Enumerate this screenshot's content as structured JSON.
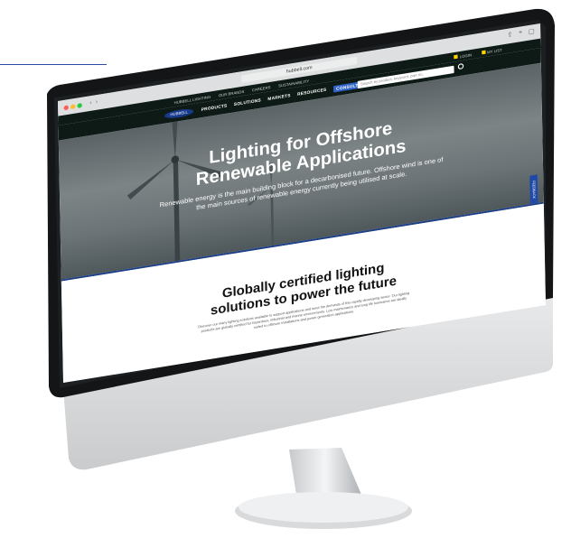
{
  "browser": {
    "url": "hubbell.com",
    "nav_back_icon": "chevron-left-icon",
    "nav_forward_icon": "chevron-right-icon"
  },
  "site": {
    "top_links": [
      "HUBBELL LIGHTING",
      "OUR BRANDS",
      "CAREERS",
      "SUSTAINABILITY"
    ],
    "login_label": "LOGIN",
    "my_list_label": "MY LIST",
    "logo_text": "HUBBELL",
    "menu": [
      "PRODUCTS",
      "SOLUTIONS",
      "MARKETS",
      "RESOURCES",
      "CONSULTING"
    ],
    "search_placeholder": "Search by product, keyword, part no.",
    "feedback_label": "FEEDBACK"
  },
  "hero": {
    "title_line1": "Lighting for Offshore",
    "title_line2": "Renewable Applications",
    "subtitle": "Renewable energy is the main building block for a decarbonised future. Offshore wind is one of the main sources of renewable energy currently being utilised at scale."
  },
  "section": {
    "heading_line1": "Globally certified lighting",
    "heading_line2": "solutions to power the future",
    "body": "Discover our many lighting solutions available to support applications and meet the demands of this rapidly developing sector. Our lighting products are globally certified for hazardous, industrial and marine environments. Low maintenance and long life luminaires are ideally suited to offshore installations and power generation applications."
  },
  "colors": {
    "accent_line": "#2a4aa3",
    "site_nav": "#0e1a16",
    "consulting_button": "#2f63c9",
    "feedback_tab": "#1f4aa8"
  }
}
